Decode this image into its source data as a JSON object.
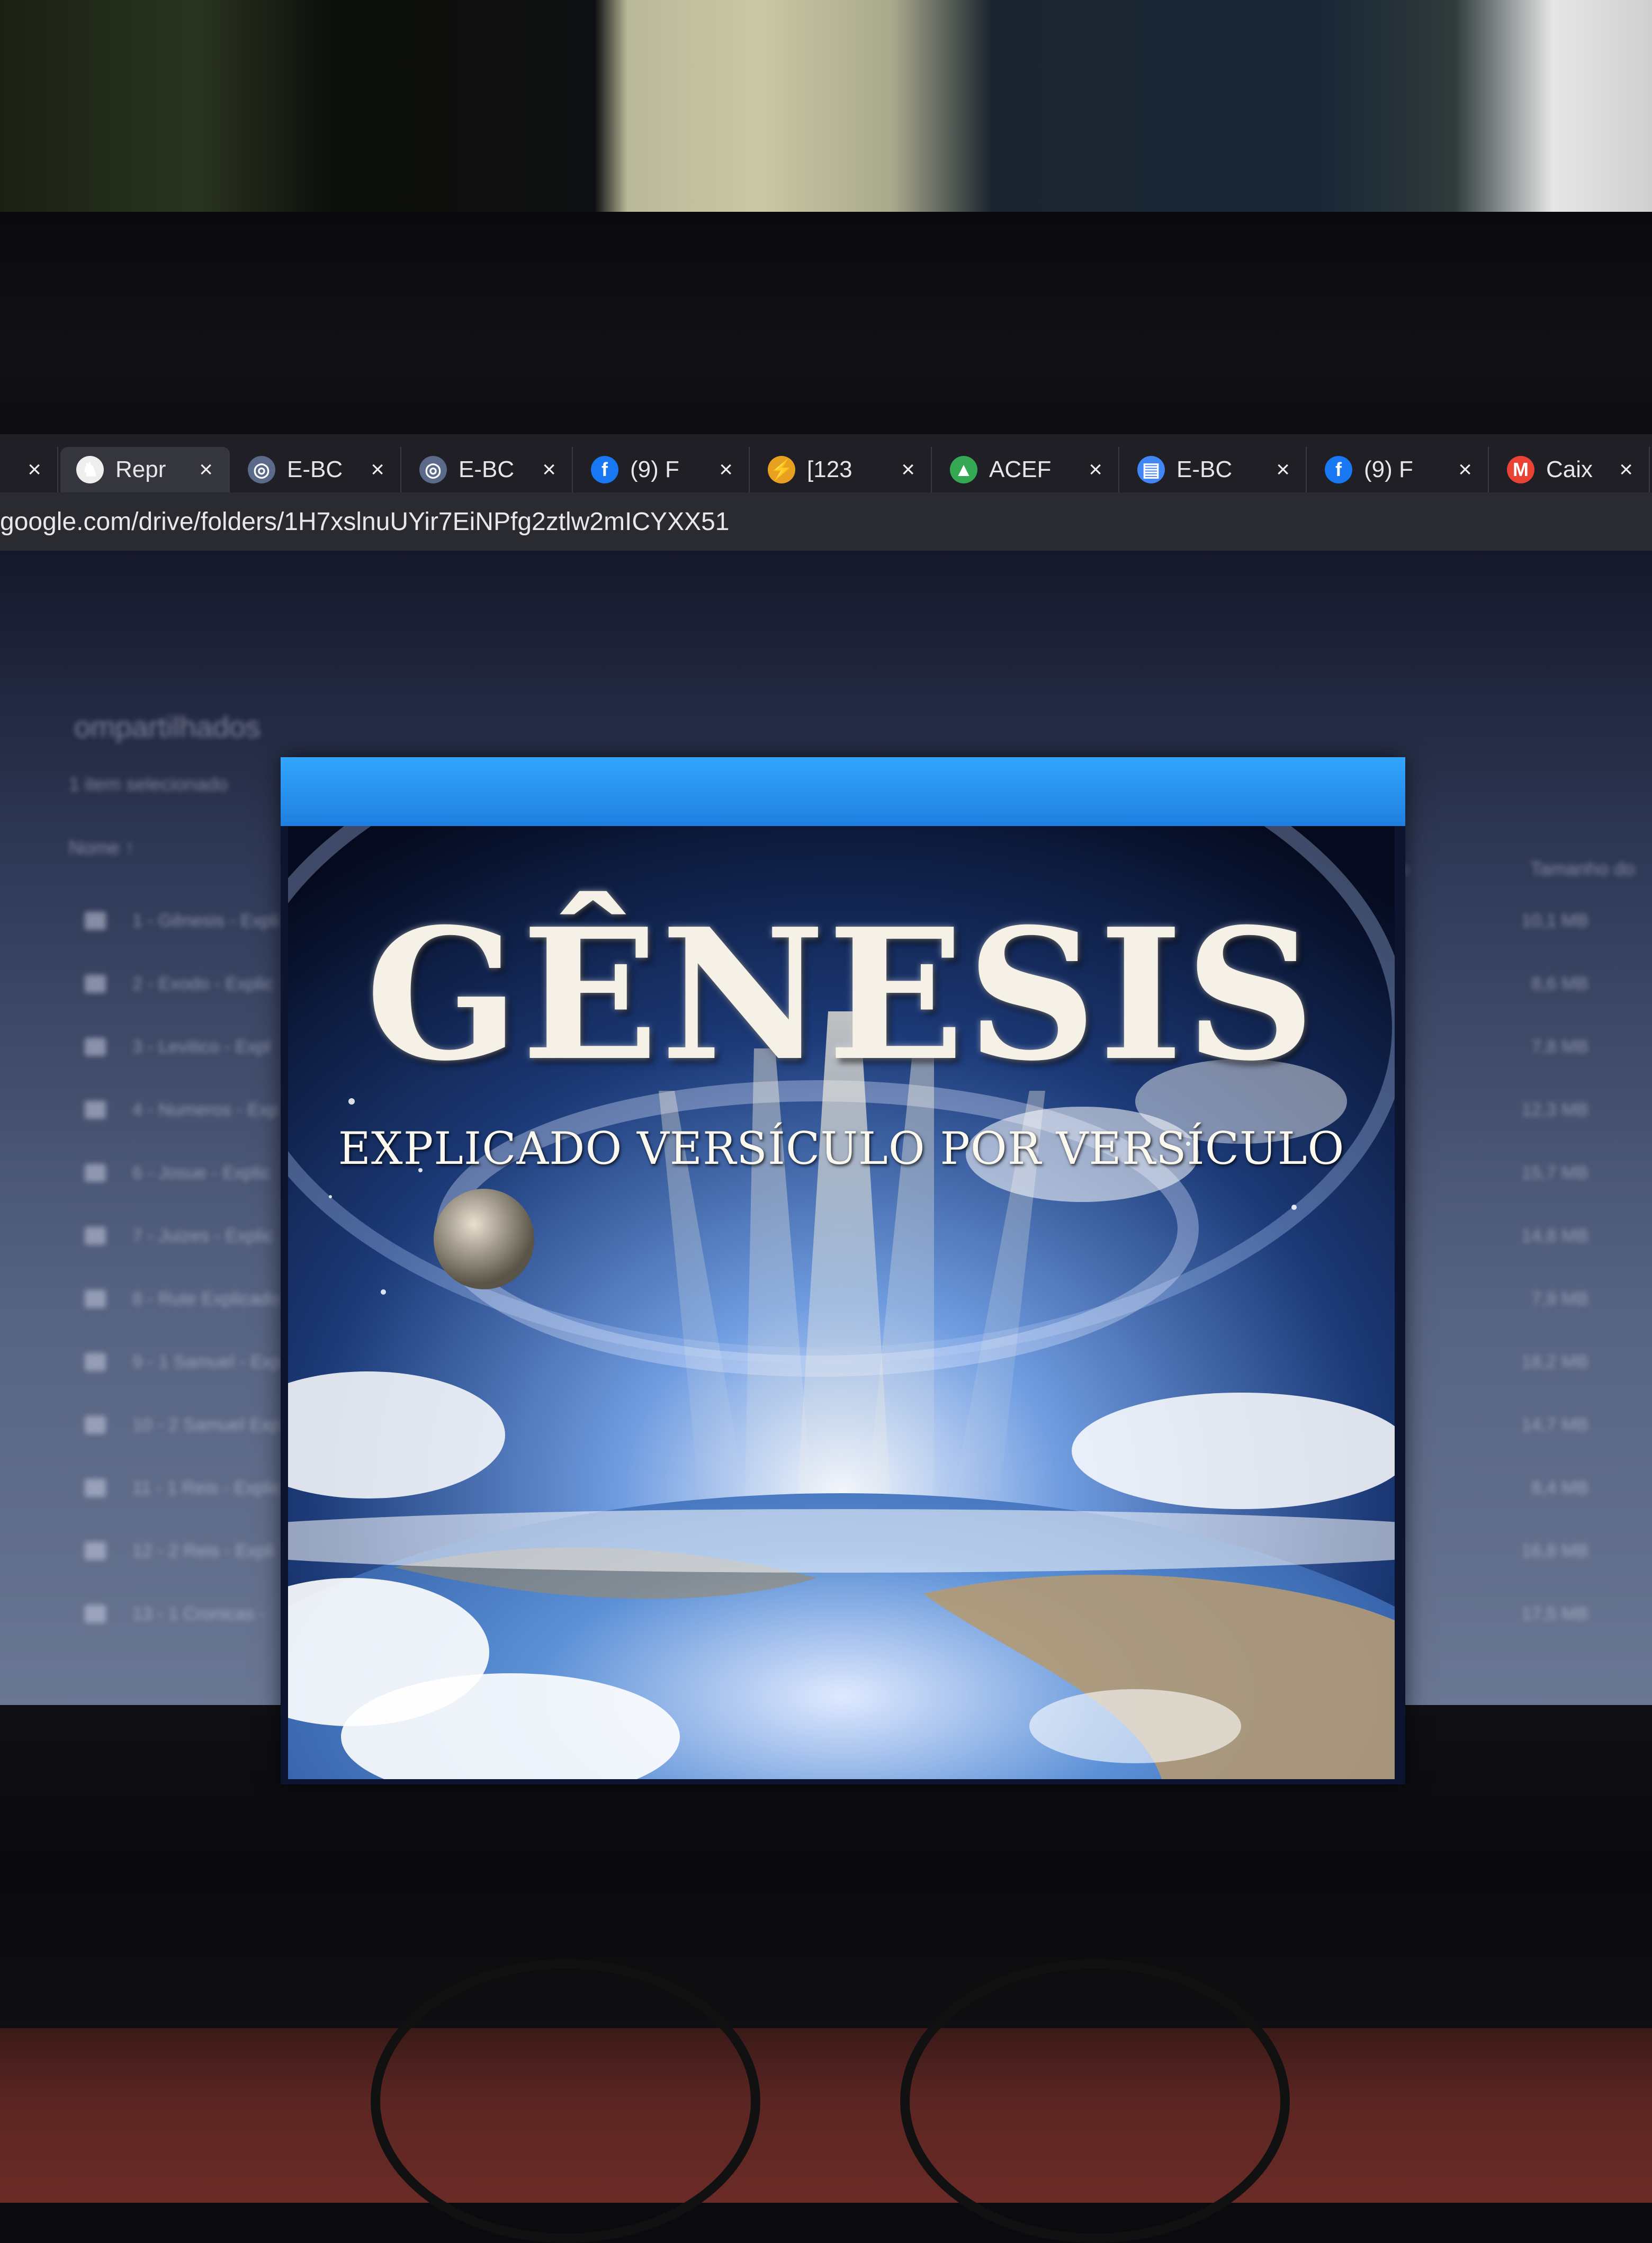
{
  "browser": {
    "tabs": [
      {
        "label": "",
        "icon": "close-icon",
        "color": "#2b2b31"
      },
      {
        "label": "Repr",
        "icon": "cat-icon",
        "color": "#eeeeee"
      },
      {
        "label": "E-BC",
        "icon": "globe-icon",
        "color": "#5a6a88"
      },
      {
        "label": "E-BC",
        "icon": "globe-icon",
        "color": "#5a6a88"
      },
      {
        "label": "(9) F",
        "icon": "facebook-icon",
        "color": "#1877f2"
      },
      {
        "label": "[123",
        "icon": "bolt-icon",
        "color": "#e8a020"
      },
      {
        "label": "ACEF",
        "icon": "drive-icon",
        "color": "#34a853"
      },
      {
        "label": "E-BC",
        "icon": "docs-icon",
        "color": "#4285f4"
      },
      {
        "label": "(9) F",
        "icon": "facebook-icon",
        "color": "#1877f2"
      },
      {
        "label": "Caix",
        "icon": "gmail-icon",
        "color": "#ea4335"
      }
    ],
    "close_glyph": "×",
    "url": "google.com/drive/folders/1H7xslnuUYir7EiNPfg2ztlw2mICYXX51"
  },
  "drive": {
    "title": "ompartilhados",
    "selection": "1 item selecionado",
    "column_name": "Nome ↑",
    "column_modified": "do",
    "column_size": "Tamanho do",
    "files": [
      {
        "name": "1 - Gênesis - Expli",
        "size": "10,1 MB"
      },
      {
        "name": "2 - Exodo - Explic",
        "size": "8,6 MB"
      },
      {
        "name": "3 - Levitico - Expl",
        "size": "7,8 MB"
      },
      {
        "name": "4 - Numeros - Exp",
        "size": "12,3 MB"
      },
      {
        "name": "6 - Josue - Explic",
        "size": "15,7 MB"
      },
      {
        "name": "7 - Juizes - Explic",
        "size": "14,8 MB"
      },
      {
        "name": "8 - Rute Explicado",
        "size": "7,9 MB"
      },
      {
        "name": "9 - 1 Samuel - Exp",
        "size": "18,2 MB"
      },
      {
        "name": "10 - 2 Samuel Exp",
        "size": "14,7 MB"
      },
      {
        "name": "11 - 1 Reis - Explic",
        "size": "8,4 MB"
      },
      {
        "name": "12 - 2 Reis - Expli",
        "size": "16,8 MB"
      },
      {
        "name": "13 - 1 Cronicas -",
        "size": "17,5 MB"
      }
    ]
  },
  "preview": {
    "title": "GÊNESIS",
    "subtitle": "EXPLICADO VERSÍCULO POR VERSÍCULO",
    "accent": "#2196f3"
  },
  "cursor_glyph": "I"
}
